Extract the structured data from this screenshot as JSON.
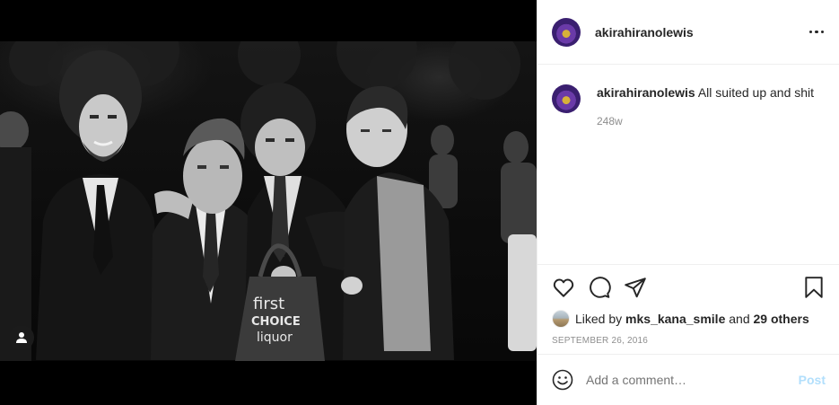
{
  "post": {
    "username": "akirahiranolewis",
    "caption": "All suited up and shit",
    "time_ago": "248w",
    "likes": {
      "prefix": "Liked by",
      "user": "mks_kana_smile",
      "connector": "and",
      "others": "29 others"
    },
    "date": "SEPTEMBER 26, 2016"
  },
  "photo": {
    "bag_text_line1": "first",
    "bag_text_line2": "CHOICE",
    "bag_text_line3": "liquor"
  },
  "comment_box": {
    "placeholder": "Add a comment…",
    "post_label": "Post"
  },
  "icons": {
    "more": "more-horizontal-icon",
    "like": "heart-icon",
    "comment": "comment-bubble-icon",
    "share": "paper-plane-icon",
    "save": "bookmark-icon",
    "emoji": "smiley-icon",
    "user_tag": "person-icon"
  },
  "colors": {
    "text": "#262626",
    "secondary": "#8e8e8e",
    "divider": "#efefef",
    "post_disabled": "#b2dffc"
  }
}
